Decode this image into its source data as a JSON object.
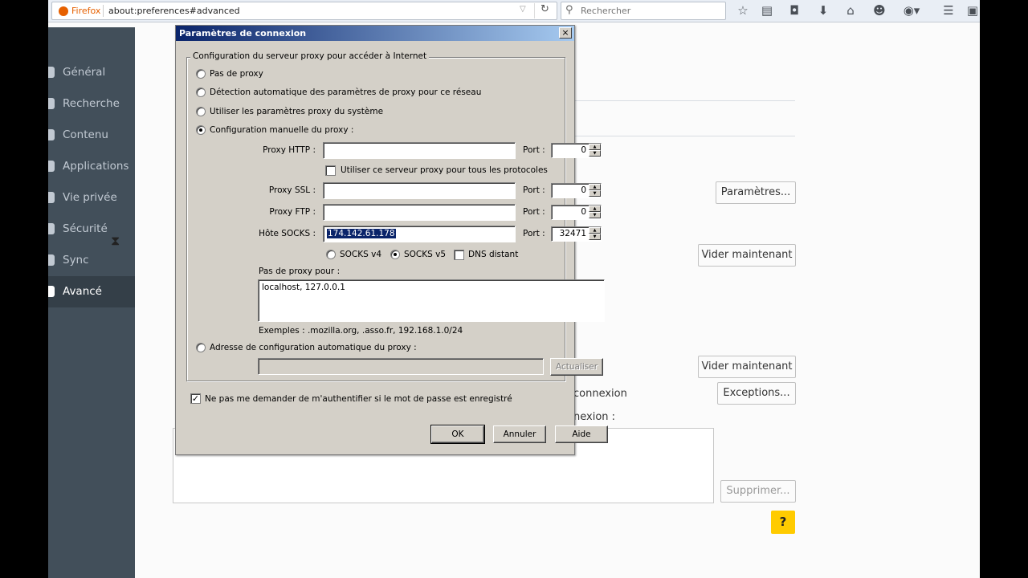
{
  "browser": {
    "brand": "Firefox",
    "url": "about:preferences#advanced",
    "search_placeholder": "Rechercher",
    "icons": [
      "bookmark-star-icon",
      "reading-list-icon",
      "pocket-icon",
      "download-icon",
      "home-icon",
      "hello-icon",
      "adblock-icon",
      "menu-icon",
      "page-icon"
    ]
  },
  "sidebar": {
    "items": [
      {
        "label": "Général",
        "icon": "general-icon"
      },
      {
        "label": "Recherche",
        "icon": "search-icon"
      },
      {
        "label": "Contenu",
        "icon": "content-icon"
      },
      {
        "label": "Applications",
        "icon": "applications-icon"
      },
      {
        "label": "Vie privée",
        "icon": "privacy-icon"
      },
      {
        "label": "Sécurité",
        "icon": "security-icon"
      },
      {
        "label": "Sync",
        "icon": "sync-icon"
      },
      {
        "label": "Avancé",
        "icon": "advanced-icon",
        "active": true
      }
    ]
  },
  "page": {
    "parametres_button": "Paramètres...",
    "vider1_button": "Vider maintenant",
    "vider2_button": "Vider maintenant",
    "exceptions_button": "Exceptions...",
    "supprimer_button": "Supprimer...",
    "connexion_text": "connexion",
    "connexion_text2": "nexion :",
    "help": "?"
  },
  "dialog": {
    "title": "Paramètres de connexion",
    "close": "×",
    "group_label": "Configuration du serveur proxy pour accéder à Internet",
    "options": {
      "no_proxy": "Pas de proxy",
      "auto_detect": "Détection automatique des paramètres de proxy pour ce réseau",
      "system": "Utiliser les paramètres proxy du système",
      "manual": "Configuration manuelle du proxy :",
      "auto_url": "Adresse de configuration automatique du proxy :"
    },
    "selected_option": "manual",
    "http": {
      "label": "Proxy HTTP :",
      "value": "",
      "port_label": "Port :",
      "port": "0"
    },
    "use_for_all": "Utiliser ce serveur proxy pour tous les protocoles",
    "ssl": {
      "label": "Proxy SSL :",
      "value": "",
      "port_label": "Port :",
      "port": "0"
    },
    "ftp": {
      "label": "Proxy FTP :",
      "value": "",
      "port_label": "Port :",
      "port": "0"
    },
    "socks": {
      "label": "Hôte SOCKS :",
      "value": "174.142.61.178",
      "port_label": "Port :",
      "port": "32471"
    },
    "socks_v4": "SOCKS v4",
    "socks_v5": "SOCKS v5",
    "dns_remote": "DNS distant",
    "no_proxy_for_label": "Pas de proxy pour :",
    "no_proxy_for_value": "localhost, 127.0.0.1",
    "examples": "Exemples : .mozilla.org, .asso.fr, 192.168.1.0/24",
    "auto_url_value": "",
    "reload_button": "Actualiser",
    "no_auth_prompt": "Ne pas me demander de m'authentifier si le mot de passe est enregistré",
    "ok": "OK",
    "cancel": "Annuler",
    "help": "Aide"
  }
}
